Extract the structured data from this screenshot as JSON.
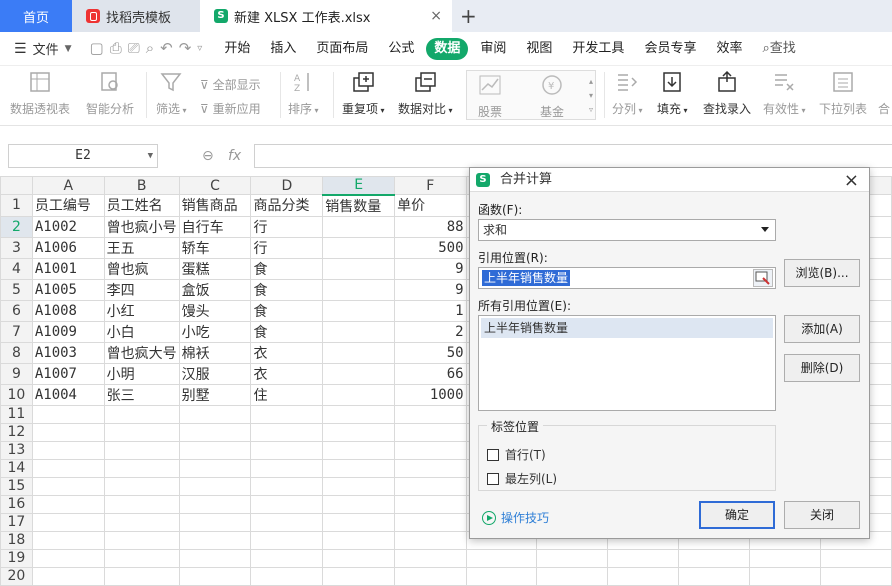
{
  "tabs": {
    "home": "首页",
    "template": "找稻壳模板",
    "file": "新建 XLSX 工作表.xlsx",
    "close": "×",
    "add": "+"
  },
  "menu": {
    "file": "文件",
    "items": [
      "开始",
      "插入",
      "页面布局",
      "公式",
      "数据",
      "审阅",
      "视图",
      "开发工具",
      "会员专享",
      "效率",
      "查找"
    ]
  },
  "ribbon": {
    "pivot": "数据透视表",
    "smart": "智能分析",
    "filter": "筛选",
    "show_all": "全部显示",
    "reapply": "重新应用",
    "sort": "排序",
    "dup": "重复项",
    "compare": "数据对比",
    "stock": "股票",
    "fund": "基金",
    "split": "分列",
    "fill": "填充",
    "lookup": "查找录入",
    "validity": "有效性",
    "dropdown": "下拉列表",
    "merge_partial": "合"
  },
  "formula_bar": {
    "name_box": "E2",
    "fx": "fx"
  },
  "sheet": {
    "columns": [
      "A",
      "B",
      "C",
      "D",
      "E",
      "F"
    ],
    "rows": [
      [
        "员工编号",
        "员工姓名",
        "销售商品",
        "商品分类",
        "销售数量",
        "单价"
      ],
      [
        "A1002",
        "曾也疯小号",
        "自行车",
        "行",
        "",
        "88"
      ],
      [
        "A1006",
        "王五",
        "轿车",
        "行",
        "",
        "500"
      ],
      [
        "A1001",
        "曾也疯",
        "蛋糕",
        "食",
        "",
        "9"
      ],
      [
        "A1005",
        "李四",
        "盒饭",
        "食",
        "",
        "9"
      ],
      [
        "A1008",
        "小红",
        "馒头",
        "食",
        "",
        "1"
      ],
      [
        "A1009",
        "小白",
        "小吃",
        "食",
        "",
        "2"
      ],
      [
        "A1003",
        "曾也疯大号",
        "棉袄",
        "衣",
        "",
        "50"
      ],
      [
        "A1007",
        "小明",
        "汉服",
        "衣",
        "",
        "66"
      ],
      [
        "A1004",
        "张三",
        "别墅",
        "住",
        "",
        "1000"
      ],
      [
        "",
        "",
        "",
        "",
        "",
        ""
      ],
      [
        "",
        "",
        "",
        "",
        "",
        ""
      ],
      [
        "",
        "",
        "",
        "",
        "",
        ""
      ],
      [
        "",
        "",
        "",
        "",
        "",
        ""
      ],
      [
        "",
        "",
        "",
        "",
        "",
        ""
      ],
      [
        "",
        "",
        "",
        "",
        "",
        ""
      ],
      [
        "",
        "",
        "",
        "",
        "",
        ""
      ],
      [
        "",
        "",
        "",
        "",
        "",
        ""
      ],
      [
        "",
        "",
        "",
        "",
        "",
        ""
      ],
      [
        "",
        "",
        "",
        "",
        "",
        ""
      ]
    ]
  },
  "dialog": {
    "title": "合并计算",
    "function_label": "函数(F):",
    "function_value": "求和",
    "ref_label": "引用位置(R):",
    "ref_value": "上半年销售数量",
    "browse": "浏览(B)...",
    "all_refs_label": "所有引用位置(E):",
    "all_refs": [
      "上半年销售数量"
    ],
    "add": "添加(A)",
    "delete": "删除(D)",
    "label_pos": "标签位置",
    "first_row": "首行(T)",
    "left_col": "最左列(L)",
    "tips": "操作技巧",
    "ok": "确定",
    "close": "关闭"
  }
}
